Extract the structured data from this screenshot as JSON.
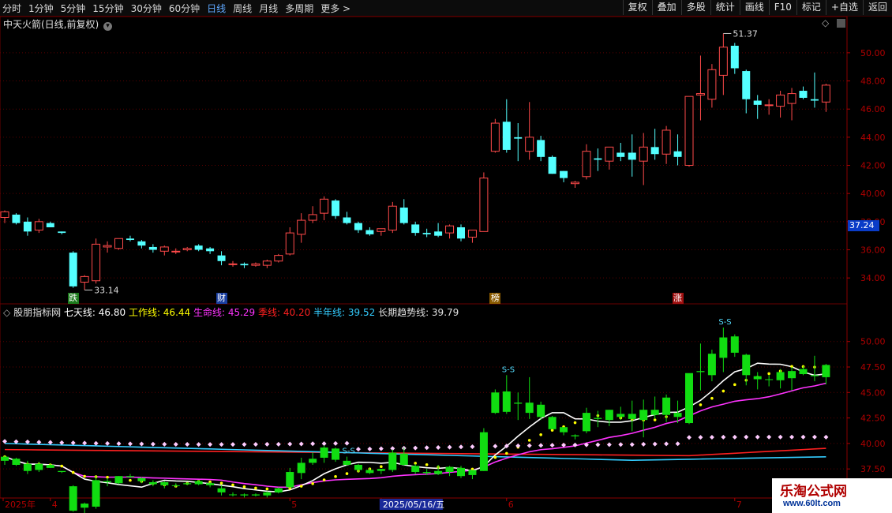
{
  "toolbar": {
    "periods": [
      {
        "label": "分时",
        "active": false
      },
      {
        "label": "1分钟",
        "active": false
      },
      {
        "label": "5分钟",
        "active": false
      },
      {
        "label": "15分钟",
        "active": false
      },
      {
        "label": "30分钟",
        "active": false
      },
      {
        "label": "60分钟",
        "active": false
      },
      {
        "label": "日线",
        "active": true
      },
      {
        "label": "周线",
        "active": false
      },
      {
        "label": "月线",
        "active": false
      },
      {
        "label": "多周期",
        "active": false
      },
      {
        "label": "更多 >",
        "active": false
      }
    ],
    "actions": [
      "复权",
      "叠加",
      "多股",
      "统计",
      "画线",
      "F10",
      "标记",
      "+自选",
      "返回"
    ]
  },
  "main_panel": {
    "title": "中天火箭(日线,前复权)",
    "current_price_tag": "37.24",
    "high_label": "51.37",
    "low_label": "33.14",
    "y_ticks": [
      "50.00",
      "48.00",
      "46.00",
      "44.00",
      "42.00",
      "40.00",
      "38.00",
      "36.00",
      "34.00"
    ],
    "badges": [
      {
        "text": "跌",
        "color": "#1d7a1d"
      },
      {
        "text": "财",
        "color": "#1a3fa0"
      },
      {
        "text": "榜",
        "color": "#8a5a00"
      },
      {
        "text": "涨",
        "color": "#a01010"
      }
    ]
  },
  "indicator_panel": {
    "name": "股朋指标网",
    "lines": [
      {
        "label": "七天线:",
        "value": "46.80",
        "color": "#ffffff"
      },
      {
        "label": "工作线:",
        "value": "46.44",
        "color": "#ffff00"
      },
      {
        "label": "生命线:",
        "value": "45.29",
        "color": "#ff33ff"
      },
      {
        "label": "季线:",
        "value": "40.20",
        "color": "#ff2020"
      },
      {
        "label": "半年线:",
        "value": "39.52",
        "color": "#33ccff"
      },
      {
        "label": "长期趋势线:",
        "value": "39.79",
        "color": "#e0e0e0"
      }
    ],
    "y_ticks": [
      "50.00",
      "47.50",
      "45.00",
      "42.50",
      "40.00",
      "37.50"
    ],
    "signal_label": "S-S"
  },
  "time_axis": {
    "labels": [
      "2025年",
      "4",
      "5",
      "2025/05/16/五",
      "6",
      "7"
    ]
  },
  "watermark": {
    "name": "乐淘公式网",
    "url": "www.60lt.com"
  },
  "chart_data": {
    "type": "candlestick",
    "symbol": "中天火箭",
    "period": "日线",
    "adjust": "前复权",
    "candles": [
      [
        38.3,
        38.8,
        37.9,
        38.7
      ],
      [
        38.5,
        38.6,
        37.8,
        37.9
      ],
      [
        38.0,
        38.3,
        37.0,
        37.3
      ],
      [
        37.4,
        38.2,
        37.2,
        38.0
      ],
      [
        37.9,
        38.0,
        37.6,
        37.6
      ],
      [
        37.3,
        37.3,
        37.1,
        37.2
      ],
      [
        35.8,
        35.9,
        33.3,
        33.4
      ],
      [
        33.7,
        34.2,
        33.14,
        34.1
      ],
      [
        33.8,
        36.8,
        33.6,
        36.4
      ],
      [
        36.2,
        36.6,
        35.8,
        36.3
      ],
      [
        36.1,
        36.8,
        36.0,
        36.8
      ],
      [
        36.8,
        37.0,
        36.6,
        36.7
      ],
      [
        36.6,
        36.7,
        36.1,
        36.3
      ],
      [
        36.2,
        36.4,
        35.8,
        36.0
      ],
      [
        35.9,
        36.3,
        35.6,
        36.2
      ],
      [
        35.9,
        36.1,
        35.7,
        35.9
      ],
      [
        36.0,
        36.2,
        35.9,
        36.1
      ],
      [
        36.3,
        36.4,
        35.9,
        36.0
      ],
      [
        36.1,
        36.2,
        35.7,
        35.9
      ],
      [
        35.6,
        35.9,
        34.9,
        35.2
      ],
      [
        35.0,
        35.2,
        34.8,
        35.0
      ],
      [
        35.0,
        35.1,
        34.7,
        34.9
      ],
      [
        34.9,
        35.1,
        34.8,
        35.0
      ],
      [
        34.9,
        35.3,
        34.7,
        35.2
      ],
      [
        35.2,
        35.7,
        35.1,
        35.6
      ],
      [
        35.7,
        37.6,
        35.6,
        37.2
      ],
      [
        37.1,
        38.6,
        36.5,
        38.1
      ],
      [
        38.1,
        39.1,
        37.9,
        38.5
      ],
      [
        38.6,
        39.8,
        38.1,
        39.6
      ],
      [
        39.5,
        39.6,
        38.2,
        38.4
      ],
      [
        38.3,
        38.7,
        37.8,
        37.9
      ],
      [
        37.9,
        38.0,
        37.2,
        37.4
      ],
      [
        37.4,
        37.6,
        37.0,
        37.1
      ],
      [
        37.3,
        37.5,
        37.0,
        37.5
      ],
      [
        37.4,
        39.4,
        37.2,
        39.1
      ],
      [
        39.0,
        39.6,
        37.8,
        37.9
      ],
      [
        37.8,
        38.0,
        37.0,
        37.2
      ],
      [
        37.2,
        37.5,
        36.9,
        37.1
      ],
      [
        37.3,
        37.9,
        36.9,
        37.0
      ],
      [
        37.2,
        37.8,
        36.8,
        37.7
      ],
      [
        37.6,
        37.8,
        36.6,
        36.8
      ],
      [
        36.9,
        37.4,
        36.5,
        37.4
      ],
      [
        37.3,
        41.5,
        37.3,
        41.1
      ],
      [
        43.0,
        45.3,
        42.9,
        45.0
      ],
      [
        45.1,
        46.7,
        42.9,
        43.1
      ],
      [
        44.0,
        45.0,
        42.3,
        43.9
      ],
      [
        43.0,
        46.5,
        42.4,
        44.0
      ],
      [
        43.8,
        44.1,
        42.3,
        42.6
      ],
      [
        42.6,
        42.7,
        41.4,
        41.4
      ],
      [
        41.6,
        41.6,
        40.8,
        41.1
      ],
      [
        40.7,
        40.9,
        40.4,
        40.8
      ],
      [
        41.2,
        43.5,
        41.0,
        43.0
      ],
      [
        42.5,
        43.2,
        41.6,
        42.4
      ],
      [
        42.3,
        43.3,
        41.7,
        43.3
      ],
      [
        42.9,
        43.6,
        42.3,
        42.6
      ],
      [
        42.9,
        44.2,
        41.2,
        42.4
      ],
      [
        42.3,
        44.3,
        40.6,
        43.3
      ],
      [
        43.3,
        44.6,
        42.4,
        42.8
      ],
      [
        42.8,
        44.8,
        42.1,
        44.5
      ],
      [
        43.0,
        44.2,
        42.0,
        42.6
      ],
      [
        42.0,
        46.6,
        41.9,
        46.9
      ],
      [
        47.0,
        49.8,
        45.2,
        47.1
      ],
      [
        46.7,
        49.2,
        46.1,
        48.8
      ],
      [
        48.4,
        51.37,
        47.0,
        50.4
      ],
      [
        50.5,
        50.7,
        48.5,
        48.9
      ],
      [
        48.7,
        48.8,
        45.7,
        46.7
      ],
      [
        46.6,
        47.0,
        45.3,
        46.3
      ],
      [
        46.3,
        46.7,
        45.6,
        46.3
      ],
      [
        46.2,
        47.3,
        45.4,
        47.0
      ],
      [
        46.4,
        47.5,
        45.2,
        47.1
      ],
      [
        47.3,
        47.6,
        46.7,
        46.8
      ],
      [
        46.7,
        48.6,
        46.1,
        46.6
      ],
      [
        46.5,
        47.8,
        45.8,
        47.7
      ]
    ],
    "price_axis": {
      "ylim": [
        33.0,
        51.9
      ]
    },
    "indicator": {
      "ylim": [
        35.5,
        52.3
      ],
      "series": [
        {
          "name": "七天线",
          "value": 46.8,
          "color": "#ffffff"
        },
        {
          "name": "工作线",
          "value": 46.44,
          "color": "#ffff00"
        },
        {
          "name": "生命线",
          "value": 45.29,
          "color": "#ff33ff"
        },
        {
          "name": "季线",
          "value": 40.2,
          "color": "#ff2020"
        },
        {
          "name": "半年线",
          "value": 39.52,
          "color": "#33ccff"
        },
        {
          "name": "长期趋势线",
          "value": 39.79,
          "color": "#e0e0e0"
        }
      ]
    }
  }
}
